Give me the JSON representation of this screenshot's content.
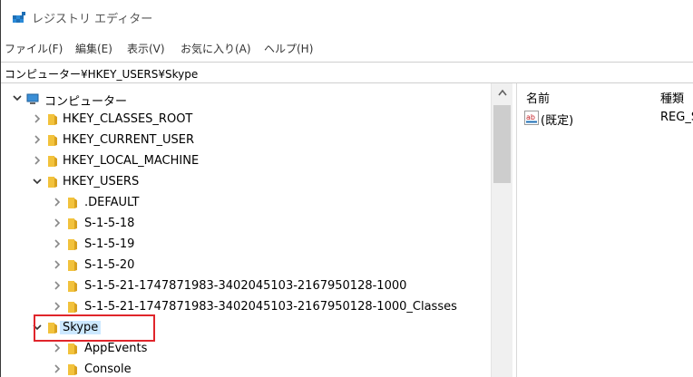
{
  "window": {
    "title": "レジストリ エディター"
  },
  "menu": [
    "ファイル(F)",
    "編集(E)",
    "表示(V)",
    "お気に入り(A)",
    "ヘルプ(H)"
  ],
  "address": "コンピューター¥HKEY_USERS¥Skype",
  "tree": [
    {
      "label": "コンピューター",
      "depth": 0,
      "state": "expanded",
      "icon": "computer-icon"
    },
    {
      "label": "HKEY_CLASSES_ROOT",
      "depth": 1,
      "state": "collapsed",
      "icon": "folder-icon"
    },
    {
      "label": "HKEY_CURRENT_USER",
      "depth": 1,
      "state": "collapsed",
      "icon": "folder-icon"
    },
    {
      "label": "HKEY_LOCAL_MACHINE",
      "depth": 1,
      "state": "collapsed",
      "icon": "folder-icon"
    },
    {
      "label": "HKEY_USERS",
      "depth": 1,
      "state": "expanded",
      "icon": "folder-icon"
    },
    {
      "label": ".DEFAULT",
      "depth": 2,
      "state": "collapsed",
      "icon": "folder-icon"
    },
    {
      "label": "S-1-5-18",
      "depth": 2,
      "state": "collapsed",
      "icon": "folder-icon"
    },
    {
      "label": "S-1-5-19",
      "depth": 2,
      "state": "collapsed",
      "icon": "folder-icon"
    },
    {
      "label": "S-1-5-20",
      "depth": 2,
      "state": "collapsed",
      "icon": "folder-icon"
    },
    {
      "label": "S-1-5-21-1747871983-3402045103-2167950128-1000",
      "depth": 2,
      "state": "collapsed",
      "icon": "folder-icon"
    },
    {
      "label": "S-1-5-21-1747871983-3402045103-2167950128-1000_Classes",
      "depth": 2,
      "state": "collapsed",
      "icon": "folder-icon"
    },
    {
      "label": "Skype",
      "depth": 1,
      "state": "expanded",
      "icon": "folder-icon",
      "selected": true
    },
    {
      "label": "AppEvents",
      "depth": 2,
      "state": "collapsed",
      "icon": "folder-icon"
    },
    {
      "label": "Console",
      "depth": 2,
      "state": "collapsed",
      "icon": "folder-icon"
    }
  ],
  "list": {
    "columns": [
      "名前",
      "種類"
    ],
    "rows": [
      {
        "name": "(既定)",
        "type": "REG_S",
        "icon": "string-value-icon"
      }
    ]
  },
  "colors": {
    "highlight_box": "#e0252b",
    "folder": "#f2c23c",
    "selection": "#cce8ff"
  }
}
